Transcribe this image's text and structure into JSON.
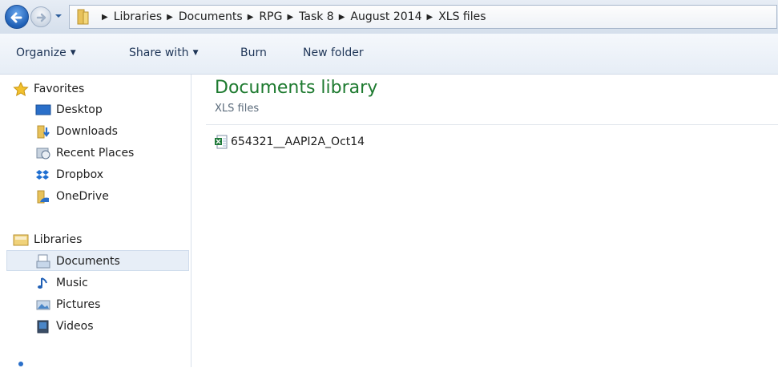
{
  "address": {
    "breadcrumbs": [
      "Libraries",
      "Documents",
      "RPG",
      "Task 8",
      "August 2014",
      "XLS files"
    ]
  },
  "toolbar": {
    "organize": "Organize",
    "share_with": "Share with",
    "burn": "Burn",
    "new_folder": "New folder"
  },
  "nav": {
    "favorites": {
      "label": "Favorites",
      "items": [
        "Desktop",
        "Downloads",
        "Recent Places",
        "Dropbox",
        "OneDrive"
      ]
    },
    "libraries": {
      "label": "Libraries",
      "items": [
        "Documents",
        "Music",
        "Pictures",
        "Videos"
      ],
      "selected": "Documents"
    }
  },
  "main": {
    "title": "Documents library",
    "subtitle": "XLS files",
    "files": [
      "654321__AAPI2A_Oct14"
    ]
  },
  "colors": {
    "accent_green": "#1d7a2f",
    "selection": "#e7eef7"
  }
}
